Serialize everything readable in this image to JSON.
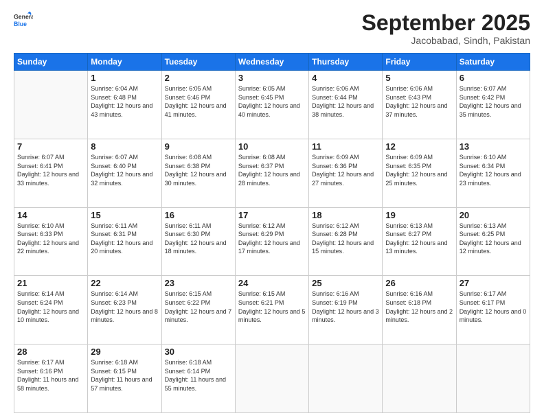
{
  "header": {
    "logo_general": "General",
    "logo_blue": "Blue",
    "month": "September 2025",
    "location": "Jacobabad, Sindh, Pakistan"
  },
  "weekdays": [
    "Sunday",
    "Monday",
    "Tuesday",
    "Wednesday",
    "Thursday",
    "Friday",
    "Saturday"
  ],
  "weeks": [
    [
      {
        "day": "",
        "sunrise": "",
        "sunset": "",
        "daylight": ""
      },
      {
        "day": "1",
        "sunrise": "6:04 AM",
        "sunset": "6:48 PM",
        "daylight": "12 hours and 43 minutes."
      },
      {
        "day": "2",
        "sunrise": "6:05 AM",
        "sunset": "6:46 PM",
        "daylight": "12 hours and 41 minutes."
      },
      {
        "day": "3",
        "sunrise": "6:05 AM",
        "sunset": "6:45 PM",
        "daylight": "12 hours and 40 minutes."
      },
      {
        "day": "4",
        "sunrise": "6:06 AM",
        "sunset": "6:44 PM",
        "daylight": "12 hours and 38 minutes."
      },
      {
        "day": "5",
        "sunrise": "6:06 AM",
        "sunset": "6:43 PM",
        "daylight": "12 hours and 37 minutes."
      },
      {
        "day": "6",
        "sunrise": "6:07 AM",
        "sunset": "6:42 PM",
        "daylight": "12 hours and 35 minutes."
      }
    ],
    [
      {
        "day": "7",
        "sunrise": "6:07 AM",
        "sunset": "6:41 PM",
        "daylight": "12 hours and 33 minutes."
      },
      {
        "day": "8",
        "sunrise": "6:07 AM",
        "sunset": "6:40 PM",
        "daylight": "12 hours and 32 minutes."
      },
      {
        "day": "9",
        "sunrise": "6:08 AM",
        "sunset": "6:38 PM",
        "daylight": "12 hours and 30 minutes."
      },
      {
        "day": "10",
        "sunrise": "6:08 AM",
        "sunset": "6:37 PM",
        "daylight": "12 hours and 28 minutes."
      },
      {
        "day": "11",
        "sunrise": "6:09 AM",
        "sunset": "6:36 PM",
        "daylight": "12 hours and 27 minutes."
      },
      {
        "day": "12",
        "sunrise": "6:09 AM",
        "sunset": "6:35 PM",
        "daylight": "12 hours and 25 minutes."
      },
      {
        "day": "13",
        "sunrise": "6:10 AM",
        "sunset": "6:34 PM",
        "daylight": "12 hours and 23 minutes."
      }
    ],
    [
      {
        "day": "14",
        "sunrise": "6:10 AM",
        "sunset": "6:33 PM",
        "daylight": "12 hours and 22 minutes."
      },
      {
        "day": "15",
        "sunrise": "6:11 AM",
        "sunset": "6:31 PM",
        "daylight": "12 hours and 20 minutes."
      },
      {
        "day": "16",
        "sunrise": "6:11 AM",
        "sunset": "6:30 PM",
        "daylight": "12 hours and 18 minutes."
      },
      {
        "day": "17",
        "sunrise": "6:12 AM",
        "sunset": "6:29 PM",
        "daylight": "12 hours and 17 minutes."
      },
      {
        "day": "18",
        "sunrise": "6:12 AM",
        "sunset": "6:28 PM",
        "daylight": "12 hours and 15 minutes."
      },
      {
        "day": "19",
        "sunrise": "6:13 AM",
        "sunset": "6:27 PM",
        "daylight": "12 hours and 13 minutes."
      },
      {
        "day": "20",
        "sunrise": "6:13 AM",
        "sunset": "6:25 PM",
        "daylight": "12 hours and 12 minutes."
      }
    ],
    [
      {
        "day": "21",
        "sunrise": "6:14 AM",
        "sunset": "6:24 PM",
        "daylight": "12 hours and 10 minutes."
      },
      {
        "day": "22",
        "sunrise": "6:14 AM",
        "sunset": "6:23 PM",
        "daylight": "12 hours and 8 minutes."
      },
      {
        "day": "23",
        "sunrise": "6:15 AM",
        "sunset": "6:22 PM",
        "daylight": "12 hours and 7 minutes."
      },
      {
        "day": "24",
        "sunrise": "6:15 AM",
        "sunset": "6:21 PM",
        "daylight": "12 hours and 5 minutes."
      },
      {
        "day": "25",
        "sunrise": "6:16 AM",
        "sunset": "6:19 PM",
        "daylight": "12 hours and 3 minutes."
      },
      {
        "day": "26",
        "sunrise": "6:16 AM",
        "sunset": "6:18 PM",
        "daylight": "12 hours and 2 minutes."
      },
      {
        "day": "27",
        "sunrise": "6:17 AM",
        "sunset": "6:17 PM",
        "daylight": "12 hours and 0 minutes."
      }
    ],
    [
      {
        "day": "28",
        "sunrise": "6:17 AM",
        "sunset": "6:16 PM",
        "daylight": "11 hours and 58 minutes."
      },
      {
        "day": "29",
        "sunrise": "6:18 AM",
        "sunset": "6:15 PM",
        "daylight": "11 hours and 57 minutes."
      },
      {
        "day": "30",
        "sunrise": "6:18 AM",
        "sunset": "6:14 PM",
        "daylight": "11 hours and 55 minutes."
      },
      {
        "day": "",
        "sunrise": "",
        "sunset": "",
        "daylight": ""
      },
      {
        "day": "",
        "sunrise": "",
        "sunset": "",
        "daylight": ""
      },
      {
        "day": "",
        "sunrise": "",
        "sunset": "",
        "daylight": ""
      },
      {
        "day": "",
        "sunrise": "",
        "sunset": "",
        "daylight": ""
      }
    ]
  ],
  "labels": {
    "sunrise_prefix": "Sunrise: ",
    "sunset_prefix": "Sunset: ",
    "daylight_prefix": "Daylight: "
  }
}
